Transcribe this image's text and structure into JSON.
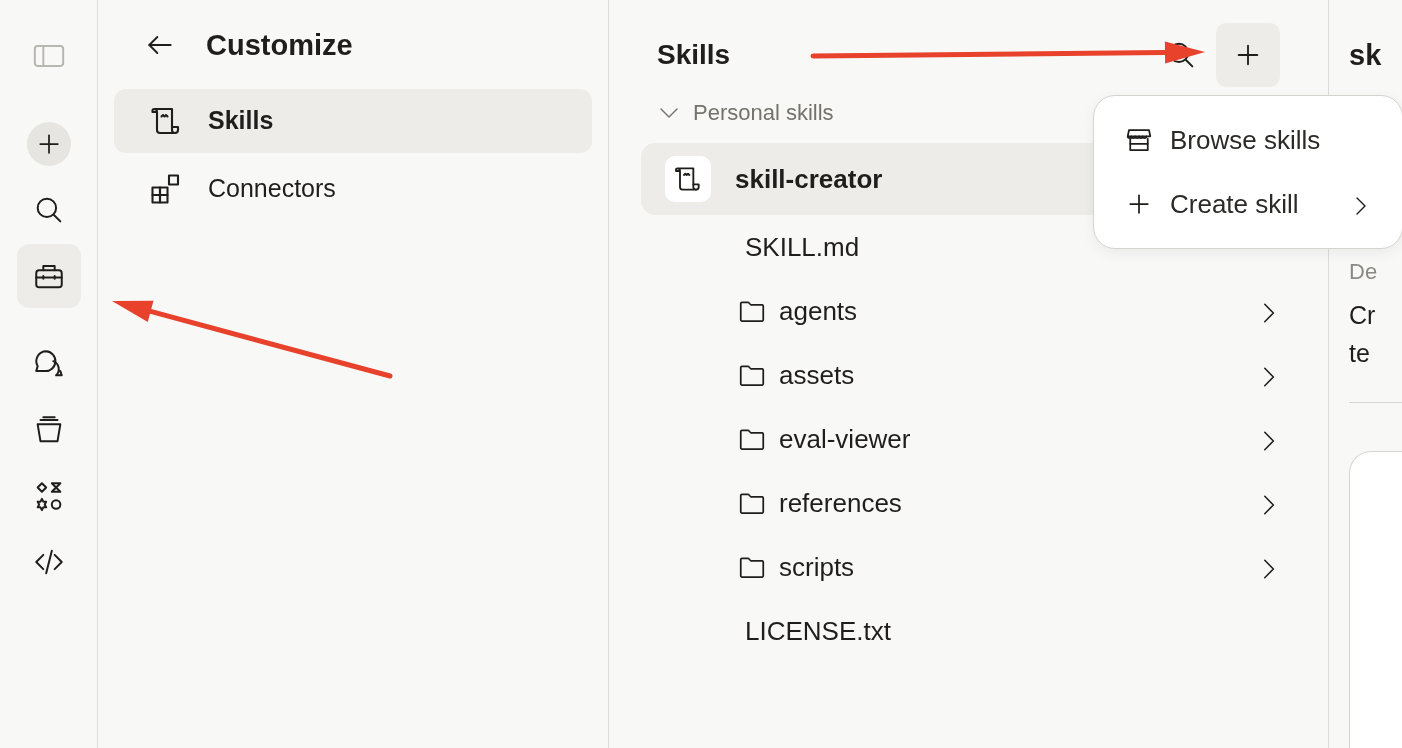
{
  "rail": {
    "items": [
      {
        "kind": "sidebar",
        "selected": false
      },
      {
        "kind": "new",
        "selected": false
      },
      {
        "kind": "search",
        "selected": false
      },
      {
        "kind": "toolbox",
        "selected": true
      },
      {
        "kind": "chats",
        "selected": false
      },
      {
        "kind": "projects",
        "selected": false
      },
      {
        "kind": "artifacts",
        "selected": false
      },
      {
        "kind": "code",
        "selected": false
      }
    ]
  },
  "customize": {
    "title": "Customize",
    "items": [
      {
        "kind": "skills",
        "label": "Skills",
        "selected": true
      },
      {
        "kind": "connectors",
        "label": "Connectors",
        "selected": false
      }
    ]
  },
  "skills_panel": {
    "title": "Skills",
    "section": {
      "label": "Personal skills",
      "expanded": true
    },
    "skill": {
      "name": "skill-creator",
      "selected": true
    },
    "files": [
      {
        "kind": "file",
        "name": "SKILL.md"
      },
      {
        "kind": "folder",
        "name": "agents"
      },
      {
        "kind": "folder",
        "name": "assets"
      },
      {
        "kind": "folder",
        "name": "eval-viewer"
      },
      {
        "kind": "folder",
        "name": "references"
      },
      {
        "kind": "folder",
        "name": "scripts"
      },
      {
        "kind": "file",
        "name": "LICENSE.txt"
      }
    ]
  },
  "menu": {
    "items": [
      {
        "kind": "browse",
        "label": "Browse skills",
        "submenu": false
      },
      {
        "kind": "create",
        "label": "Create skill",
        "submenu": true
      }
    ]
  },
  "detail": {
    "title": "sk",
    "label": "De",
    "description": [
      "Cr",
      "te"
    ]
  },
  "annotations": [
    {
      "kind": "arrow"
    },
    {
      "kind": "arrow"
    }
  ]
}
